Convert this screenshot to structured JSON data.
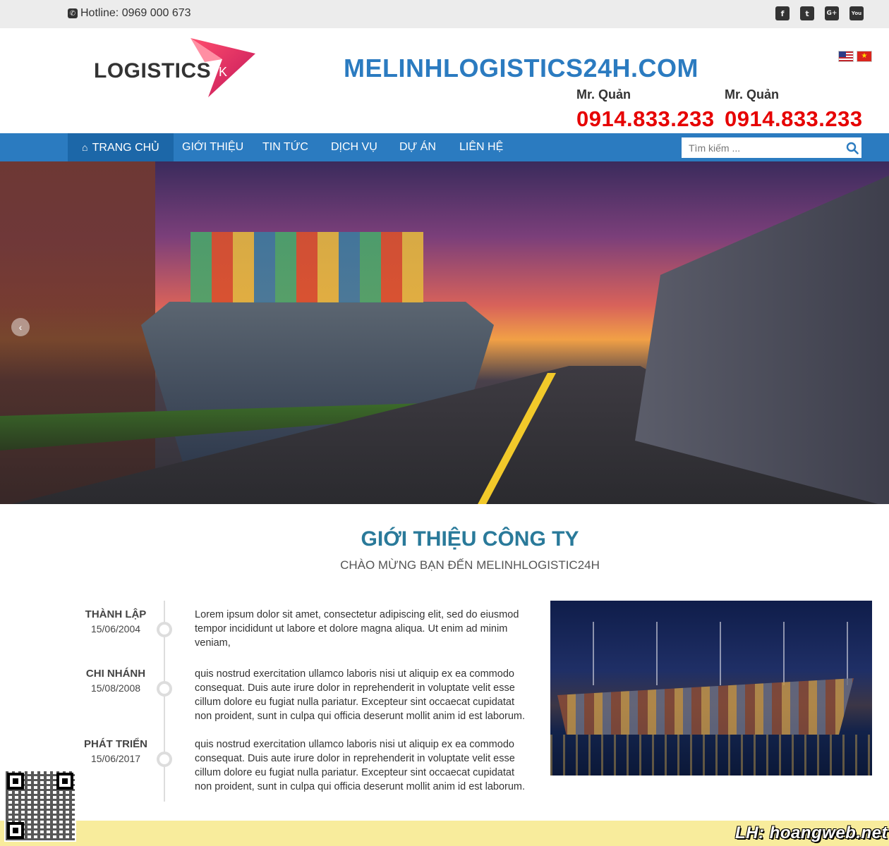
{
  "topbar": {
    "hotline": "Hotline: 0969 000 673",
    "social": [
      {
        "icon": "facebook-icon",
        "glyph": "f"
      },
      {
        "icon": "twitter-icon",
        "glyph": "t"
      },
      {
        "icon": "google-plus-icon",
        "glyph": "G+"
      },
      {
        "icon": "youtube-icon",
        "glyph": "You"
      }
    ]
  },
  "header": {
    "logo_text": "LOGISTICS",
    "logo_suffix": "K",
    "site_title": "MELINHLOGISTICS24H.COM",
    "contacts": [
      {
        "name": "Mr. Quản",
        "phone": "0914.833.233"
      },
      {
        "name": "Mr. Quản",
        "phone": "0914.833.233"
      }
    ],
    "languages": [
      "English",
      "Tiếng Việt"
    ]
  },
  "nav": {
    "items": [
      {
        "label": "TRANG CHỦ",
        "active": true
      },
      {
        "label": "GIỚI THIỆU"
      },
      {
        "label": "TIN TỨC"
      },
      {
        "label": "DỊCH VỤ"
      },
      {
        "label": "DỰ ÁN"
      },
      {
        "label": "LIÊN HỆ"
      }
    ],
    "search_placeholder": "Tìm kiếm ..."
  },
  "hero": {
    "prev_arrow": "‹"
  },
  "intro": {
    "title": "GIỚI THIỆU CÔNG TY",
    "subtitle": "CHÀO MỪNG BẠN ĐẾN MELINHLOGISTIC24H",
    "timeline": [
      {
        "heading": "THÀNH LẬP",
        "date": "15/06/2004",
        "text": "Lorem ipsum dolor sit amet, consectetur adipiscing elit, sed do eiusmod tempor incididunt ut labore et dolore magna aliqua. Ut enim ad minim veniam,"
      },
      {
        "heading": "CHI NHÁNH",
        "date": "15/08/2008",
        "text": "quis nostrud exercitation ullamco laboris nisi ut aliquip ex ea commodo consequat. Duis aute irure dolor in reprehenderit in voluptate velit esse cillum dolore eu fugiat nulla pariatur. Excepteur sint occaecat cupidatat non proident, sunt in culpa qui officia deserunt mollit anim id est laborum."
      },
      {
        "heading": "PHÁT TRIỂN",
        "date": "15/06/2017",
        "text": "quis nostrud exercitation ullamco laboris nisi ut aliquip ex ea commodo consequat. Duis aute irure dolor in reprehenderit in voluptate velit esse cillum dolore eu fugiat nulla pariatur. Excepteur sint occaecat cupidatat non proident, sunt in culpa qui officia deserunt mollit anim id est laborum."
      }
    ]
  },
  "footer": {
    "watermark": "LH: hoangweb.net"
  },
  "colors": {
    "brand_blue": "#2b7bc0",
    "phone_red": "#e60000",
    "section_title": "#2a7a9a",
    "footer_yellow": "#f8ec9c"
  }
}
